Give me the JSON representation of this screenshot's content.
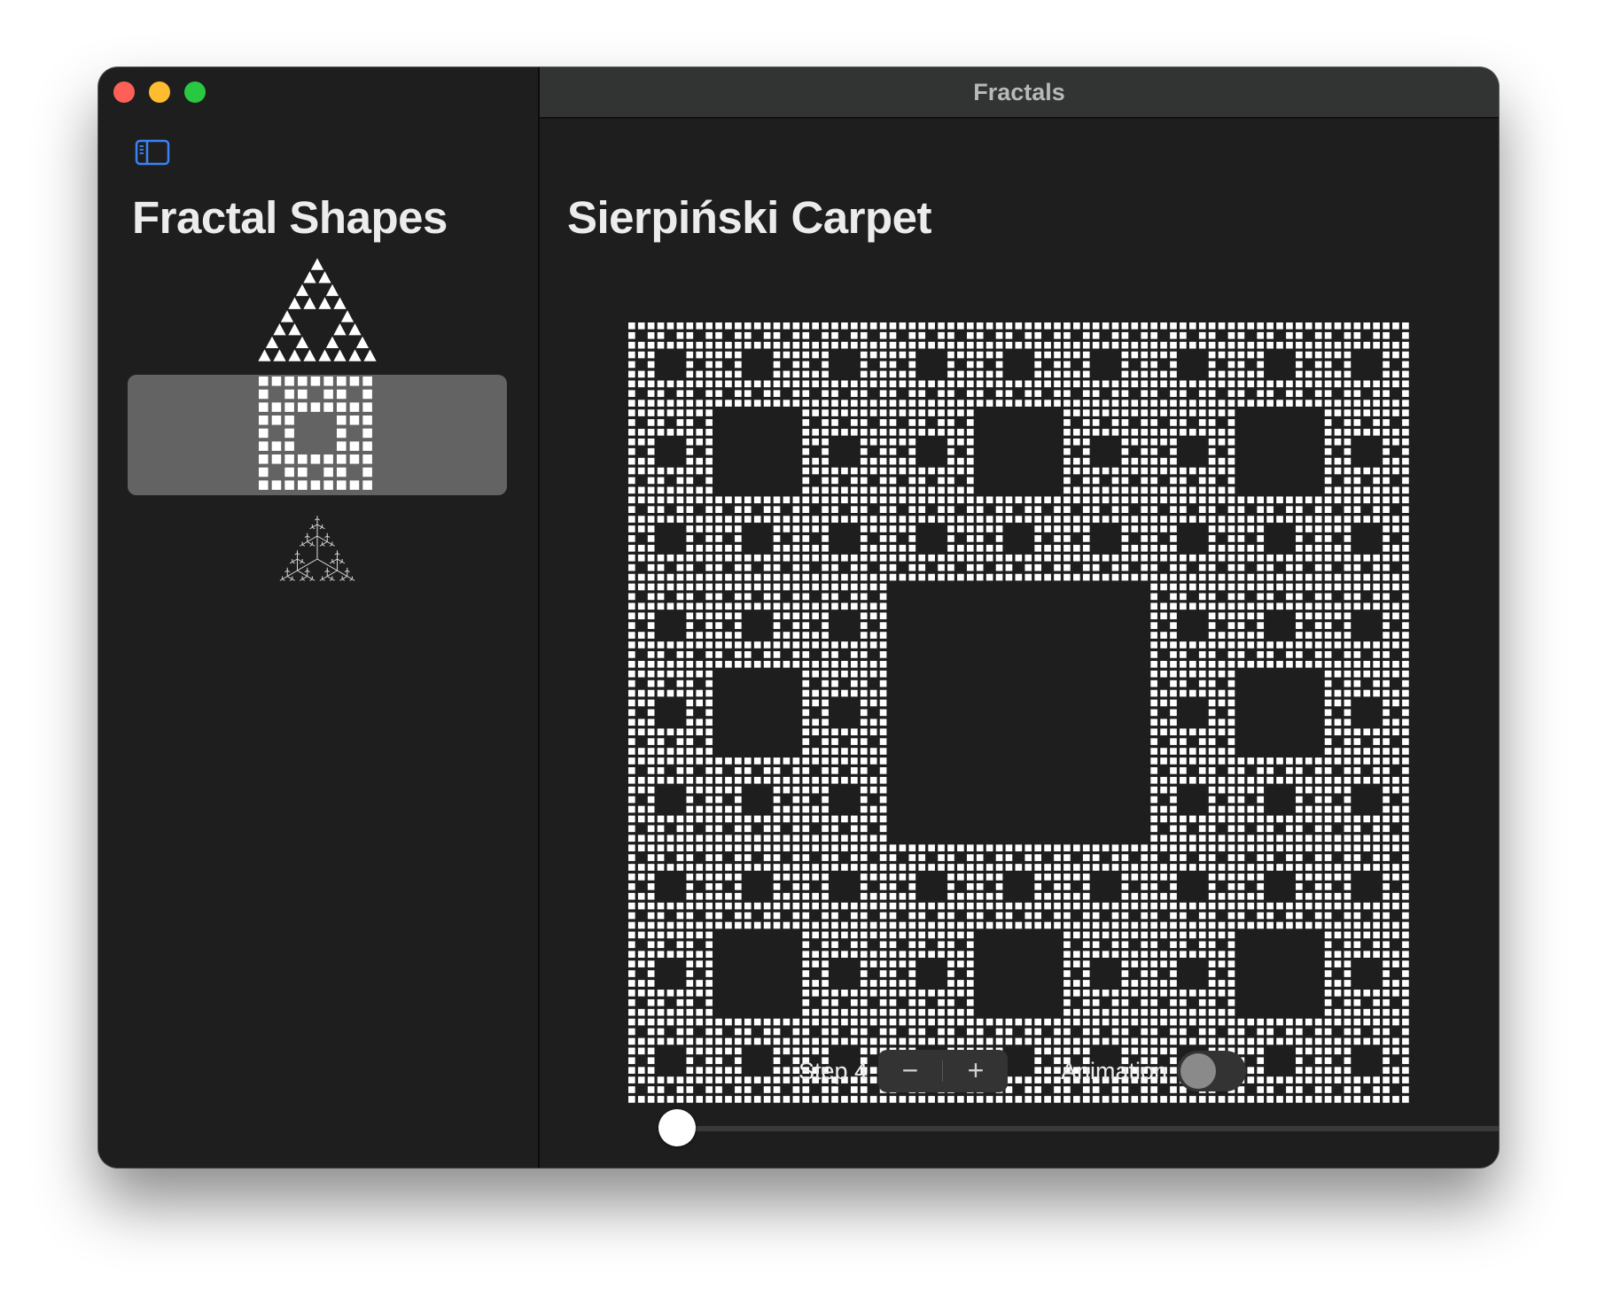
{
  "window": {
    "title": "Fractals"
  },
  "sidebar": {
    "title": "Fractal Shapes",
    "items": [
      {
        "name": "sierpinski-triangle",
        "icon": "triangle-fractal-icon",
        "selected": false
      },
      {
        "name": "sierpinski-carpet",
        "icon": "carpet-fractal-icon",
        "selected": true
      },
      {
        "name": "fractal-tree",
        "icon": "tree-fractal-icon",
        "selected": false
      }
    ]
  },
  "detail": {
    "title": "Sierpiński Carpet",
    "step_label": "Step 4",
    "step": 4,
    "stepper": {
      "minus": "−",
      "plus": "+"
    },
    "animation_label": "Animation",
    "animation_on": false,
    "slider_value": 0
  },
  "colors": {
    "window_bg": "#1e1e1e",
    "selection": "#636363",
    "accent": "#3b82f6",
    "fractal": "#ffffff"
  }
}
